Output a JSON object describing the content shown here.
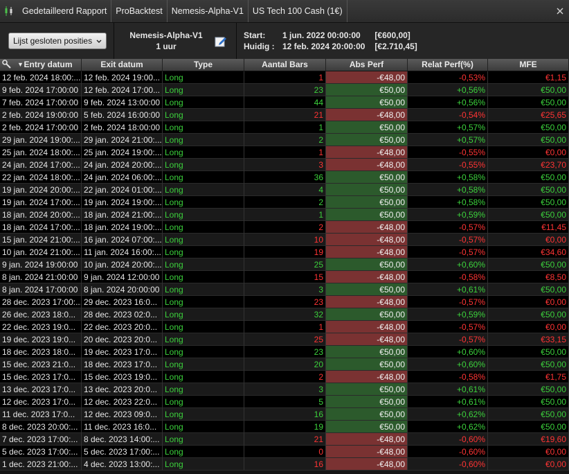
{
  "breadcrumbs": [
    "Gedetailleerd Rapport",
    "ProBacktest",
    "Nemesis-Alpha-V1",
    "US Tech 100 Cash (1€)"
  ],
  "view_selector": "Lijst gesloten posities",
  "system": {
    "name": "Nemesis-Alpha-V1",
    "timeframe": "1 uur"
  },
  "dates": {
    "start_label": "Start:",
    "start_date": "1 jun. 2022 00:00:00",
    "start_amount": "[€600,00]",
    "current_label": "Huidig :",
    "current_date": "12 feb. 2024 20:00:00",
    "current_amount": "[€2.710,45]"
  },
  "columns": [
    "Entry datum",
    "Exit datum",
    "Type",
    "Aantal Bars",
    "Abs Perf",
    "Relat Perf(%)",
    "MFE"
  ],
  "colors": {
    "positive": "#3cd23c",
    "negative": "#ff3434",
    "pos_bg": "#2c5a2c",
    "neg_bg": "#7a3232"
  },
  "rows": [
    [
      "12 feb. 2024 18:00:...",
      "12 feb. 2024 19:00...",
      "Long",
      "1",
      "-€48,00",
      "-0,53%",
      "€1,15"
    ],
    [
      "9 feb. 2024 17:00:00",
      "12 feb. 2024 17:00...",
      "Long",
      "23",
      "€50,00",
      "+0,56%",
      "€50,00"
    ],
    [
      "7 feb. 2024 17:00:00",
      "9 feb. 2024 13:00:00",
      "Long",
      "44",
      "€50,00",
      "+0,56%",
      "€50,00"
    ],
    [
      "2 feb. 2024 19:00:00",
      "5 feb. 2024 16:00:00",
      "Long",
      "21",
      "-€48,00",
      "-0,54%",
      "€25,65"
    ],
    [
      "2 feb. 2024 17:00:00",
      "2 feb. 2024 18:00:00",
      "Long",
      "1",
      "€50,00",
      "+0,57%",
      "€50,00"
    ],
    [
      "29 jan. 2024 19:00:...",
      "29 jan. 2024 21:00:...",
      "Long",
      "2",
      "€50,00",
      "+0,57%",
      "€50,00"
    ],
    [
      "25 jan. 2024 18:00:...",
      "25 jan. 2024 19:00:...",
      "Long",
      "1",
      "-€48,00",
      "-0,55%",
      "€0,00"
    ],
    [
      "24 jan. 2024 17:00:...",
      "24 jan. 2024 20:00:...",
      "Long",
      "3",
      "-€48,00",
      "-0,55%",
      "€23,70"
    ],
    [
      "22 jan. 2024 18:00:...",
      "24 jan. 2024 06:00:...",
      "Long",
      "36",
      "€50,00",
      "+0,58%",
      "€50,00"
    ],
    [
      "19 jan. 2024 20:00:...",
      "22 jan. 2024 01:00:...",
      "Long",
      "4",
      "€50,00",
      "+0,58%",
      "€50,00"
    ],
    [
      "19 jan. 2024 17:00:...",
      "19 jan. 2024 19:00:...",
      "Long",
      "2",
      "€50,00",
      "+0,58%",
      "€50,00"
    ],
    [
      "18 jan. 2024 20:00:...",
      "18 jan. 2024 21:00:...",
      "Long",
      "1",
      "€50,00",
      "+0,59%",
      "€50,00"
    ],
    [
      "18 jan. 2024 17:00:...",
      "18 jan. 2024 19:00:...",
      "Long",
      "2",
      "-€48,00",
      "-0,57%",
      "€11,45"
    ],
    [
      "15 jan. 2024 21:00:...",
      "16 jan. 2024 07:00:...",
      "Long",
      "10",
      "-€48,00",
      "-0,57%",
      "€0,00"
    ],
    [
      "10 jan. 2024 21:00:...",
      "11 jan. 2024 16:00:...",
      "Long",
      "19",
      "-€48,00",
      "-0,57%",
      "€34,60"
    ],
    [
      "9 jan. 2024 19:00:00",
      "10 jan. 2024 20:00:...",
      "Long",
      "25",
      "€50,00",
      "+0,60%",
      "€50,00"
    ],
    [
      "8 jan. 2024 21:00:00",
      "9 jan. 2024 12:00:00",
      "Long",
      "15",
      "-€48,00",
      "-0,58%",
      "€8,50"
    ],
    [
      "8 jan. 2024 17:00:00",
      "8 jan. 2024 20:00:00",
      "Long",
      "3",
      "€50,00",
      "+0,61%",
      "€50,00"
    ],
    [
      "28 dec. 2023 17:00:...",
      "29 dec. 2023 16:0...",
      "Long",
      "23",
      "-€48,00",
      "-0,57%",
      "€0,00"
    ],
    [
      "26 dec. 2023 18:0...",
      "28 dec. 2023 02:0...",
      "Long",
      "32",
      "€50,00",
      "+0,59%",
      "€50,00"
    ],
    [
      "22 dec. 2023 19:0...",
      "22 dec. 2023 20:0...",
      "Long",
      "1",
      "-€48,00",
      "-0,57%",
      "€0,00"
    ],
    [
      "19 dec. 2023 19:0...",
      "20 dec. 2023 20:0...",
      "Long",
      "25",
      "-€48,00",
      "-0,57%",
      "€33,15"
    ],
    [
      "18 dec. 2023 18:0...",
      "19 dec. 2023 17:0...",
      "Long",
      "23",
      "€50,00",
      "+0,60%",
      "€50,00"
    ],
    [
      "15 dec. 2023 21:0...",
      "18 dec. 2023 17:0...",
      "Long",
      "20",
      "€50,00",
      "+0,60%",
      "€50,00"
    ],
    [
      "15 dec. 2023 17:0...",
      "15 dec. 2023 19:0...",
      "Long",
      "2",
      "-€48,00",
      "-0,58%",
      "€1,75"
    ],
    [
      "13 dec. 2023 17:0...",
      "13 dec. 2023 20:0...",
      "Long",
      "3",
      "€50,00",
      "+0,61%",
      "€50,00"
    ],
    [
      "12 dec. 2023 17:0...",
      "12 dec. 2023 22:0...",
      "Long",
      "5",
      "€50,00",
      "+0,61%",
      "€50,00"
    ],
    [
      "11 dec. 2023 17:0...",
      "12 dec. 2023 09:0...",
      "Long",
      "16",
      "€50,00",
      "+0,62%",
      "€50,00"
    ],
    [
      "8 dec. 2023 20:00:...",
      "11 dec. 2023 16:0...",
      "Long",
      "19",
      "€50,00",
      "+0,62%",
      "€50,00"
    ],
    [
      "7 dec. 2023 17:00:...",
      "8 dec. 2023 14:00:...",
      "Long",
      "21",
      "-€48,00",
      "-0,60%",
      "€19,60"
    ],
    [
      "5 dec. 2023 17:00:...",
      "5 dec. 2023 17:00:...",
      "Long",
      "0",
      "-€48,00",
      "-0,60%",
      "€0,00"
    ],
    [
      "1 dec. 2023 21:00:...",
      "4 dec. 2023 13:00:...",
      "Long",
      "16",
      "-€48,00",
      "-0,60%",
      "€0,00"
    ]
  ]
}
